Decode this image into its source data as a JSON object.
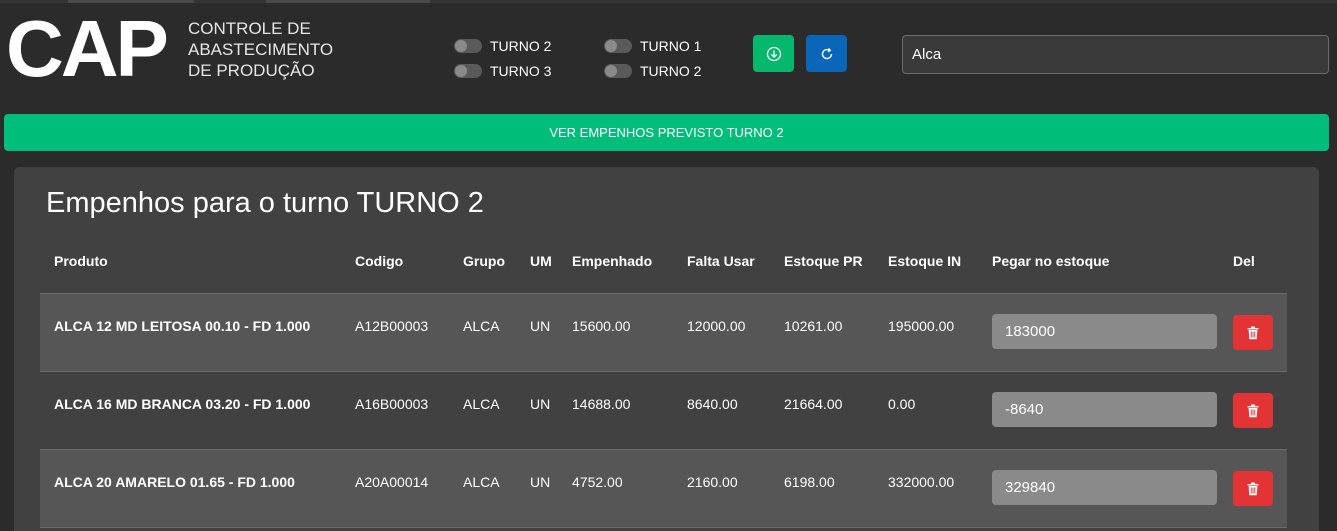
{
  "header": {
    "logo": "CAP",
    "subtitle": "CONTROLE DE ABASTECIMENTO DE PRODUÇÃO"
  },
  "toggles": [
    {
      "label": "TURNO 2",
      "checked": false
    },
    {
      "label": "TURNO 3",
      "checked": false
    },
    {
      "label": "TURNO 1",
      "checked": false
    },
    {
      "label": "TURNO 2",
      "checked": false
    }
  ],
  "toolbar": {
    "download_icon": "download-circle-icon",
    "refresh_icon": "refresh-icon"
  },
  "search": {
    "value": "Alca"
  },
  "banner": {
    "label": "VER EMPENHOS PREVISTO TURNO 2"
  },
  "card": {
    "title": "Empenhos para o turno TURNO 2",
    "columns": [
      "Produto",
      "Codigo",
      "Grupo",
      "UM",
      "Empenhado",
      "Falta Usar",
      "Estoque PR",
      "Estoque IN",
      "Pegar no estoque",
      "Del"
    ],
    "rows": [
      {
        "produto": "ALCA 12 MD LEITOSA 00.10 - FD 1.000",
        "codigo": "A12B00003",
        "grupo": "ALCA",
        "um": "UN",
        "empenhado": "15600.00",
        "falta_usar": "12000.00",
        "estoque_pr": "10261.00",
        "estoque_in": "195000.00",
        "pegar": "183000"
      },
      {
        "produto": "ALCA 16 MD BRANCA 03.20 - FD 1.000",
        "codigo": "A16B00003",
        "grupo": "ALCA",
        "um": "UN",
        "empenhado": "14688.00",
        "falta_usar": "8640.00",
        "estoque_pr": "21664.00",
        "estoque_in": "0.00",
        "pegar": "-8640"
      },
      {
        "produto": "ALCA 20 AMARELO 01.65 - FD 1.000",
        "codigo": "A20A00014",
        "grupo": "ALCA",
        "um": "UN",
        "empenhado": "4752.00",
        "falta_usar": "2160.00",
        "estoque_pr": "6198.00",
        "estoque_in": "332000.00",
        "pegar": "329840"
      }
    ]
  },
  "colors": {
    "background": "#2b2b2b",
    "accent_green": "#00bd7a",
    "accent_blue": "#0a66b8",
    "danger": "#e23434",
    "card": "#414141"
  }
}
